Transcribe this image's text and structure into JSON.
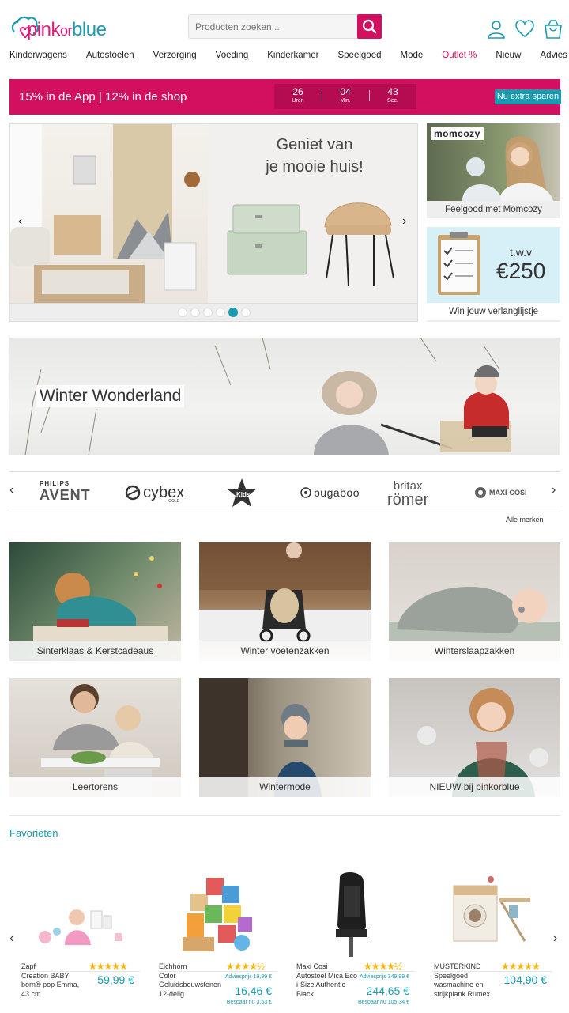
{
  "header": {
    "logo": {
      "part1": "pink",
      "part2": "or",
      "part3": "blue"
    },
    "search": {
      "placeholder": "Producten zoeken..."
    },
    "icons": [
      "user-icon",
      "heart-icon",
      "cart-icon"
    ]
  },
  "nav": {
    "items": [
      "Kinderwagens",
      "Autostoelen",
      "Verzorging",
      "Voeding",
      "Kinderkamer",
      "Speelgoed",
      "Mode",
      "Outlet %",
      "Nieuw",
      "Advies"
    ]
  },
  "promo": {
    "text": "15% in de App | 12% in de shop",
    "countdown": [
      {
        "value": "26",
        "label": "Uren"
      },
      {
        "value": "04",
        "label": "Min."
      },
      {
        "value": "43",
        "label": "Sec."
      }
    ],
    "button": "Nu extra sparen"
  },
  "hero": {
    "title_line1": "Geniet van",
    "title_line2": "je mooie huis!",
    "dots": 6,
    "active_dot": 5
  },
  "side_cards": [
    {
      "label": "Feelgood met Momcozy",
      "brand_logo": "momcozy"
    },
    {
      "label": "Win jouw verlanglijstje",
      "tag_small": "t.w.v",
      "tag_big": "€250"
    }
  ],
  "winter": {
    "title": "Winter Wonderland"
  },
  "brands": {
    "logos": [
      "PHILIPS",
      "AVENT",
      "cybex",
      "GOLD",
      "Kids",
      "bugaboo",
      "britax",
      "römer",
      "MAXI-COSI"
    ],
    "all_label": "Alle merken"
  },
  "tiles": [
    {
      "label": "Sinterklaas & Kerstcadeaus"
    },
    {
      "label": "Winter voetenzakken"
    },
    {
      "label": "Winterslaapzakken"
    },
    {
      "label": "Leertorens"
    },
    {
      "label": "Wintermode"
    },
    {
      "label": "NIEUW bij pinkorblue"
    }
  ],
  "favorites": {
    "title": "Favorieten",
    "products": [
      {
        "brand": "Zapf",
        "name": "Creation BABY born® pop Emma, 43 cm",
        "price": "59,99 €",
        "rating": 5
      },
      {
        "brand": "Eichhorn",
        "name": "Color Geluidsbouwstenen 12-delig",
        "advies": "Adviesprijs 19,99 €",
        "price": "16,46 €",
        "bespaar": "Bespaar nu 3,53 €",
        "rating": 4.5
      },
      {
        "brand": "Maxi Cosi",
        "name": "Autostoel Mica Eco i-Size Authentic Black",
        "advies": "Adviesprijs 349,99 €",
        "price": "244,65 €",
        "bespaar": "Bespaar nu 105,34 €",
        "rating": 4.5
      },
      {
        "brand": "MUSTERKIND",
        "name": "Speelgoed wasmachine en strijkplank Rumex",
        "price": "104,90 €",
        "rating": 5
      }
    ]
  },
  "colors": {
    "brand_pink": "#d3105f",
    "brand_blue": "#1a9bb0",
    "stars": "#f5b400"
  }
}
